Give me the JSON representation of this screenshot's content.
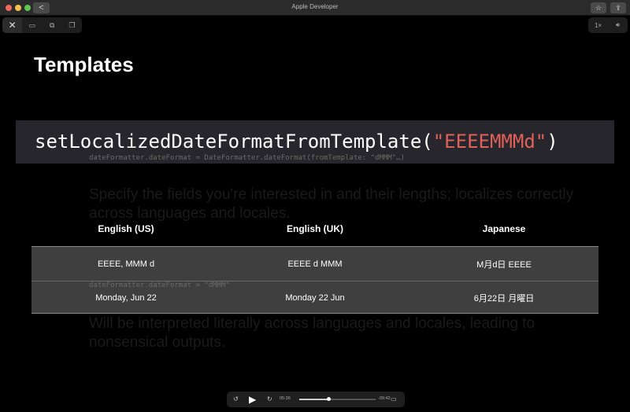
{
  "window": {
    "title": "Apple Developer",
    "back_label": "<",
    "bookmark_icon": "star-icon",
    "share_icon": "share-icon",
    "traffic_lights": [
      "#ed6a5e",
      "#f5bf4f",
      "#61c554"
    ]
  },
  "video_controls": {
    "close": "✕",
    "speed": "1×",
    "volume_icon": "speaker-icon"
  },
  "slide": {
    "heading": "Templates",
    "code_prefix": "setLocalizedDateFormatFromTemplate(",
    "code_string": "\"EEEEMMMd\"",
    "code_suffix": ")",
    "string_color": "#e0605a",
    "bg_code_1": "dateFormatter.dateFormat = DateFormatter.dateFormat(fromTemplate: \"dMMM\"…)",
    "bg_text_1": "Specify the fields you're interested in and their lengths; localizes correctly across languages and locales.",
    "bg_code_2": "dateFormatter.dateFormat = \"dMMM\"",
    "bg_text_2": "Will be interpreted literally across languages and locales, leading to nonsensical outputs.",
    "table": {
      "headers": [
        "English (US)",
        "English (UK)",
        "Japanese"
      ],
      "rows": [
        [
          "EEEE, MMM d",
          "EEEE d MMM",
          "M月d日 EEEE"
        ],
        [
          "Monday, Jun 22",
          "Monday 22 Jun",
          "6月22日 月曜日"
        ]
      ]
    }
  },
  "player": {
    "elapsed": "05:36",
    "remaining": "-09:42",
    "progress": 0.38,
    "skip_back": "15",
    "skip_forward": "15"
  }
}
